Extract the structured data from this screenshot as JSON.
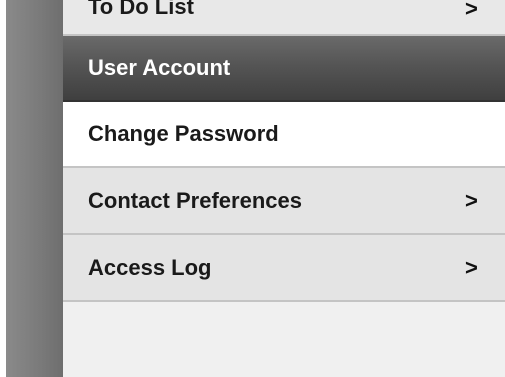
{
  "menu": {
    "todo": {
      "label": "To Do List",
      "chevron": ">"
    },
    "header": {
      "label": "User Account"
    },
    "change_password": {
      "label": "Change Password"
    },
    "contact_preferences": {
      "label": "Contact Preferences",
      "chevron": ">"
    },
    "access_log": {
      "label": "Access Log",
      "chevron": ">"
    }
  },
  "colors": {
    "rail": "#7a7a7a",
    "header_bg": "#4a4a4a",
    "item_bg": "#e4e4e4",
    "selected_bg": "#ffffff",
    "divider": "#c4c4c4"
  },
  "icons": {
    "submenu": "chevron-right-icon"
  }
}
